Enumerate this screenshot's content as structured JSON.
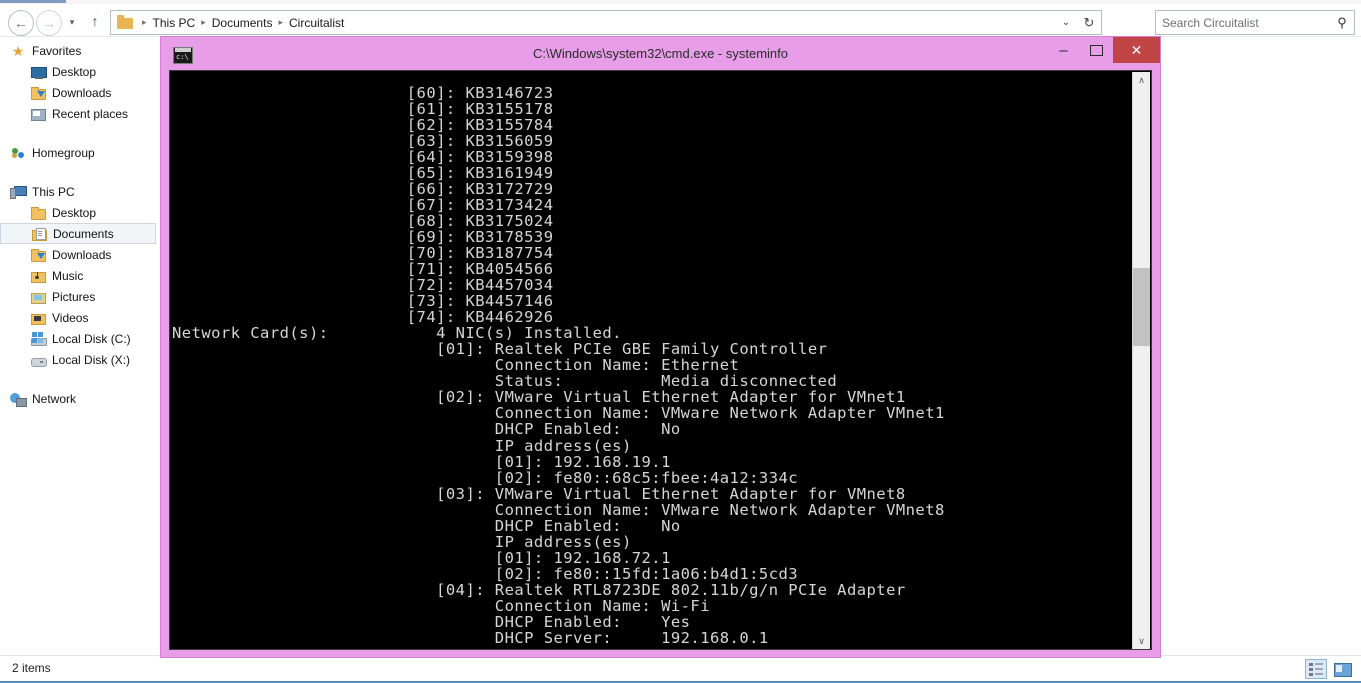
{
  "explorer": {
    "nav": {
      "back_icon": "back-arrow-icon",
      "forward_icon": "forward-arrow-icon",
      "recent_icon": "chevron-down-icon",
      "up_icon": "up-arrow-icon",
      "back_glyph": "←",
      "forward_glyph": "→",
      "recent_glyph": "▾",
      "up_glyph": "↑",
      "dropdown_glyph": "⌄",
      "refresh_glyph": "↻"
    },
    "breadcrumbs": [
      {
        "label": "This PC"
      },
      {
        "label": "Documents"
      },
      {
        "label": "Circuitalist"
      }
    ],
    "breadcrumb_separator": "▸",
    "search": {
      "placeholder": "Search Circuitalist",
      "value": "",
      "icon_glyph": "⚲"
    },
    "sidebar": {
      "groups": [
        {
          "header": {
            "label": "Favorites",
            "icon": "star-icon"
          },
          "items": [
            {
              "label": "Desktop",
              "icon": "monitor-icon",
              "selected": false
            },
            {
              "label": "Downloads",
              "icon": "downloads-folder-icon",
              "selected": false
            },
            {
              "label": "Recent places",
              "icon": "recent-places-icon",
              "selected": false
            }
          ]
        },
        {
          "header": {
            "label": "Homegroup",
            "icon": "homegroup-icon"
          },
          "items": []
        },
        {
          "header": {
            "label": "This PC",
            "icon": "this-pc-icon"
          },
          "items": [
            {
              "label": "Desktop",
              "icon": "folder-icon",
              "selected": false
            },
            {
              "label": "Documents",
              "icon": "documents-folder-icon",
              "selected": true
            },
            {
              "label": "Downloads",
              "icon": "downloads-folder-icon",
              "selected": false
            },
            {
              "label": "Music",
              "icon": "music-folder-icon",
              "selected": false
            },
            {
              "label": "Pictures",
              "icon": "pictures-folder-icon",
              "selected": false
            },
            {
              "label": "Videos",
              "icon": "videos-folder-icon",
              "selected": false
            },
            {
              "label": "Local Disk (C:)",
              "icon": "local-disk-c-icon",
              "selected": false
            },
            {
              "label": "Local Disk (X:)",
              "icon": "local-disk-x-icon",
              "selected": false
            }
          ]
        },
        {
          "header": {
            "label": "Network",
            "icon": "network-icon"
          },
          "items": []
        }
      ]
    },
    "statusbar": {
      "item_count": "2 items",
      "views": [
        {
          "name": "details-view-button",
          "active": true
        },
        {
          "name": "large-icons-view-button",
          "active": false
        }
      ]
    }
  },
  "cmd_window": {
    "title": "C:\\Windows\\system32\\cmd.exe - systeminfo",
    "icon": "cmd-icon",
    "frame_color": "#e79de7",
    "buttons": {
      "minimize": "–",
      "maximize": "☐",
      "close": "✕"
    },
    "scrollbar": {
      "up_glyph": "∧",
      "down_glyph": "∨"
    },
    "console_output": "                        [60]: KB3146723\n                        [61]: KB3155178\n                        [62]: KB3155784\n                        [63]: KB3156059\n                        [64]: KB3159398\n                        [65]: KB3161949\n                        [66]: KB3172729\n                        [67]: KB3173424\n                        [68]: KB3175024\n                        [69]: KB3178539\n                        [70]: KB3187754\n                        [71]: KB4054566\n                        [72]: KB4457034\n                        [73]: KB4457146\n                        [74]: KB4462926\nNetwork Card(s):           4 NIC(s) Installed.\n                           [01]: Realtek PCIe GBE Family Controller\n                                 Connection Name: Ethernet\n                                 Status:          Media disconnected\n                           [02]: VMware Virtual Ethernet Adapter for VMnet1\n                                 Connection Name: VMware Network Adapter VMnet1\n                                 DHCP Enabled:    No\n                                 IP address(es)\n                                 [01]: 192.168.19.1\n                                 [02]: fe80::68c5:fbee:4a12:334c\n                           [03]: VMware Virtual Ethernet Adapter for VMnet8\n                                 Connection Name: VMware Network Adapter VMnet8\n                                 DHCP Enabled:    No\n                                 IP address(es)\n                                 [01]: 192.168.72.1\n                                 [02]: fe80::15fd:1a06:b4d1:5cd3\n                           [04]: Realtek RTL8723DE 802.11b/g/n PCIe Adapter\n                                 Connection Name: Wi-Fi\n                                 DHCP Enabled:    Yes\n                                 DHCP Server:     192.168.0.1"
  }
}
